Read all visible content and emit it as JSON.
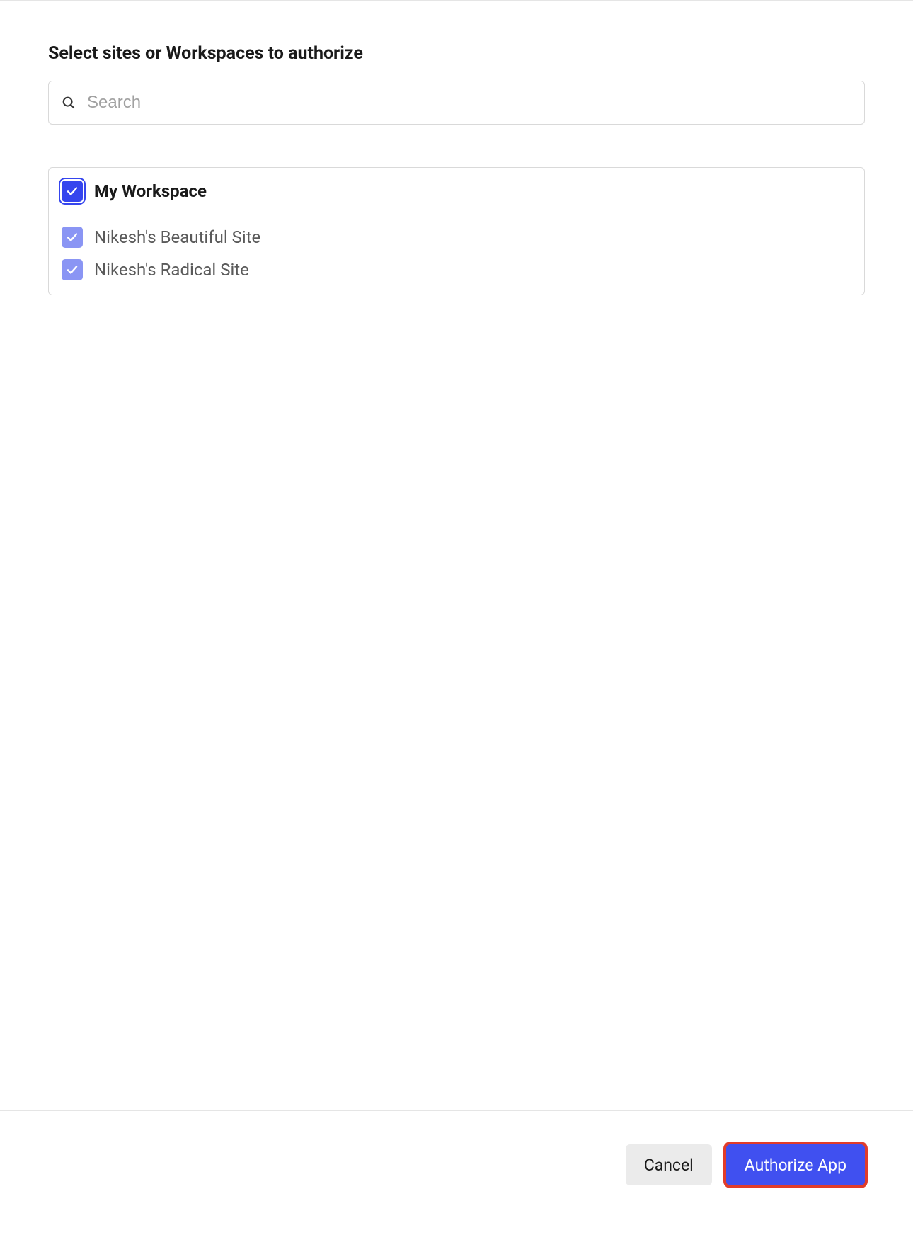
{
  "heading": "Select sites or Workspaces to authorize",
  "search": {
    "placeholder": "Search",
    "value": ""
  },
  "workspace": {
    "label": "My Workspace",
    "checked": true,
    "sites": [
      {
        "label": "Nikesh's Beautiful Site",
        "checked": true
      },
      {
        "label": "Nikesh's Radical Site",
        "checked": true
      }
    ]
  },
  "footer": {
    "cancel_label": "Cancel",
    "authorize_label": "Authorize App"
  },
  "colors": {
    "primary": "#3545ee",
    "primary_light": "#8a95f4",
    "highlight_ring": "#e13c2a"
  }
}
